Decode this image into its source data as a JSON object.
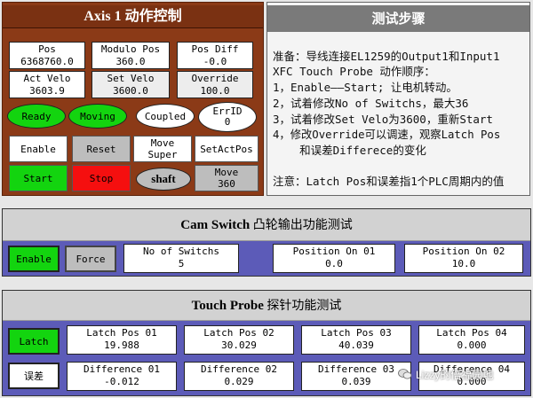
{
  "axis": {
    "title": "Axis 1 动作控制",
    "fields": [
      {
        "label": "Pos",
        "value": "6368760.0"
      },
      {
        "label": "Modulo Pos",
        "value": "360.0"
      },
      {
        "label": "Pos Diff",
        "value": "-0.0"
      },
      {
        "label": "Act Velo",
        "value": "3603.9"
      },
      {
        "label": "Set Velo",
        "value": "3600.0"
      },
      {
        "label": "Override",
        "value": "100.0"
      }
    ],
    "status": {
      "ready": "Ready",
      "moving": "Moving",
      "coupled": "Coupled",
      "errid_label": "ErrID",
      "errid_value": "0"
    },
    "buttons": {
      "enable": "Enable",
      "reset": "Reset",
      "move_super_1": "Move",
      "move_super_2": "Super",
      "set_act_pos": "SetActPos",
      "start": "Start",
      "stop": "Stop",
      "shaft": "shaft",
      "move360_1": "Move",
      "move360_2": "360"
    }
  },
  "steps": {
    "title": "测试步骤",
    "lines": [
      "准备：导线连接EL1259的Output1和Input1",
      "XFC Touch Probe 动作顺序：",
      "1，Enable——Start; 让电机转动。",
      "2，试着修改No of Switchs，最大36",
      "3，试着修改Set Velo为3600，重新Start",
      "4，修改Override可以调速，观察Latch Pos",
      "    和误差Differece的变化",
      "注意：Latch Pos和误差指1个PLC周期内的值"
    ]
  },
  "cam": {
    "title_bold": "Cam Switch",
    "title_rest": " 凸轮输出功能测试",
    "enable": "Enable",
    "force": "Force",
    "fields": [
      {
        "label": "No of Switchs",
        "value": "5"
      },
      {
        "label": "Position On 01",
        "value": "0.0"
      },
      {
        "label": "Position On 02",
        "value": "10.0"
      }
    ]
  },
  "touch": {
    "title_bold": "Touch Probe",
    "title_rest": " 探针功能测试",
    "latch_btn": "Latch",
    "diff_btn": "误差",
    "latch": [
      {
        "label": "Latch Pos 01",
        "value": "19.988"
      },
      {
        "label": "Latch Pos 02",
        "value": "30.029"
      },
      {
        "label": "Latch Pos 03",
        "value": "40.039"
      },
      {
        "label": "Latch Pos 04",
        "value": "0.000"
      }
    ],
    "diff": [
      {
        "label": "Difference 01",
        "value": "-0.012"
      },
      {
        "label": "Difference 02",
        "value": "0.029"
      },
      {
        "label": "Difference 03",
        "value": "0.039"
      },
      {
        "label": "Difference 04",
        "value": "0.000"
      }
    ]
  },
  "watermark": "Lizzy的倍福园地",
  "colors": {
    "green": "#13d40f",
    "red": "#f50f0f",
    "brown": "#8b3a17",
    "blue_bar": "#5c5bb8"
  }
}
